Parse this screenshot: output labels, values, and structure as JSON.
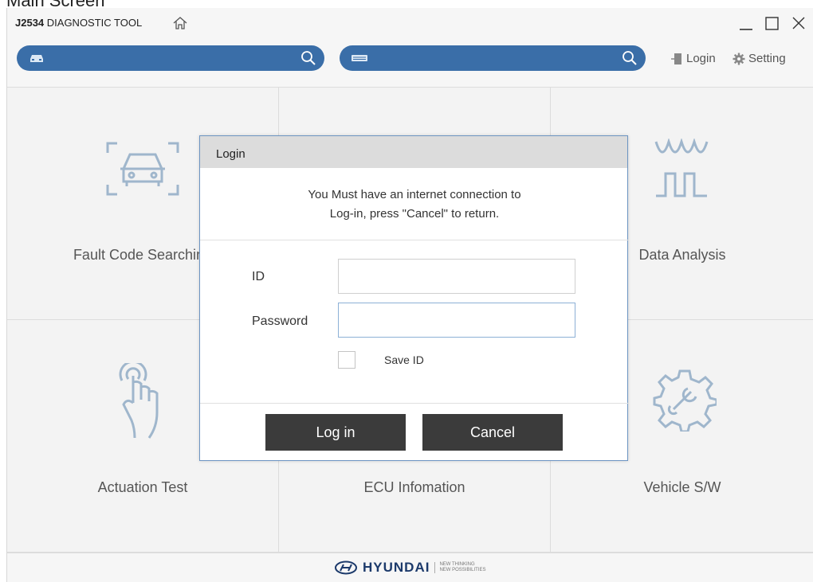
{
  "caption": "Main Screen",
  "window": {
    "title_bold": "J2534",
    "title_rest": " DIAGNOSTIC TOOL"
  },
  "toolbar": {
    "login_label": "Login",
    "setting_label": "Setting"
  },
  "tiles": [
    {
      "label": "Fault Code Searching",
      "icon": "car-scan-icon"
    },
    {
      "label": "",
      "icon": "hidden-icon"
    },
    {
      "label": "Data Analysis",
      "icon": "waveform-icon"
    },
    {
      "label": "Actuation Test",
      "icon": "touch-hand-icon"
    },
    {
      "label": "ECU Infomation",
      "icon": "ecu-icon"
    },
    {
      "label": "Vehicle S/W",
      "icon": "gear-wrench-icon"
    }
  ],
  "dialog": {
    "title": "Login",
    "message_line1": "You Must have an internet connection to",
    "message_line2": "Log-in, press \"Cancel\" to return.",
    "id_label": "ID",
    "id_value": "",
    "password_label": "Password",
    "password_value": "",
    "save_id_label": "Save ID",
    "save_id_checked": false,
    "login_button": "Log in",
    "cancel_button": "Cancel"
  },
  "footer": {
    "brand": "HYUNDAI",
    "tagline_1": "NEW THINKING",
    "tagline_2": "NEW POSSIBILITIES"
  },
  "colors": {
    "accent": "#3a6ea8",
    "icon": "#9fb6cc",
    "button_dark": "#3b3b3b",
    "dialog_border": "#6c94c2"
  }
}
